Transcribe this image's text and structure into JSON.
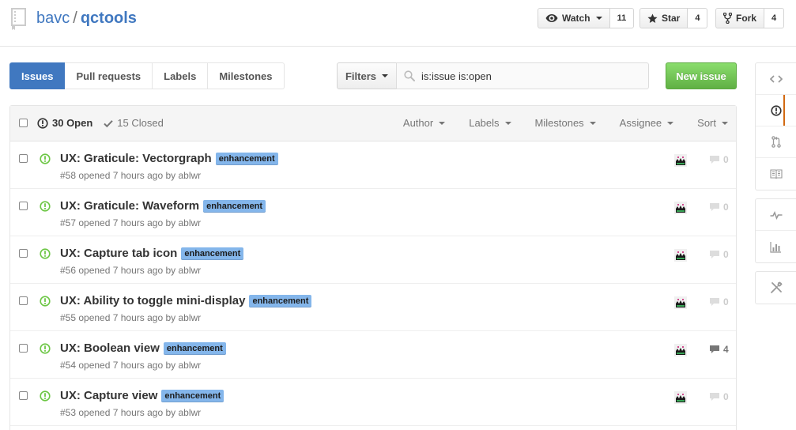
{
  "repo": {
    "owner": "bavc",
    "separator": "/",
    "name": "qctools"
  },
  "actions": {
    "watch": {
      "label": "Watch",
      "count": "11"
    },
    "star": {
      "label": "Star",
      "count": "4"
    },
    "fork": {
      "label": "Fork",
      "count": "4"
    }
  },
  "subnav": {
    "tabs": [
      {
        "label": "Issues",
        "selected": true
      },
      {
        "label": "Pull requests"
      },
      {
        "label": "Labels"
      },
      {
        "label": "Milestones"
      }
    ],
    "filters_label": "Filters",
    "search_value": "is:issue is:open",
    "new_issue_label": "New issue"
  },
  "table": {
    "open_label": "30 Open",
    "closed_label": "15 Closed",
    "menus": [
      "Author",
      "Labels",
      "Milestones",
      "Assignee",
      "Sort"
    ]
  },
  "issues": [
    {
      "title": "UX: Graticule: Vectorgraph",
      "label": "enhancement",
      "meta": "#58 opened 7 hours ago by ",
      "author": "ablwr",
      "comments": "0"
    },
    {
      "title": "UX: Graticule: Waveform",
      "label": "enhancement",
      "meta": "#57 opened 7 hours ago by ",
      "author": "ablwr",
      "comments": "0"
    },
    {
      "title": "UX: Capture tab icon",
      "label": "enhancement",
      "meta": "#56 opened 7 hours ago by ",
      "author": "ablwr",
      "comments": "0"
    },
    {
      "title": "UX: Ability to toggle mini-display",
      "label": "enhancement",
      "meta": "#55 opened 7 hours ago by ",
      "author": "ablwr",
      "comments": "0"
    },
    {
      "title": "UX: Boolean view",
      "label": "enhancement",
      "meta": "#54 opened 7 hours ago by ",
      "author": "ablwr",
      "comments": "4"
    },
    {
      "title": "UX: Capture view",
      "label": "enhancement",
      "meta": "#53 opened 7 hours ago by ",
      "author": "ablwr",
      "comments": "0"
    }
  ],
  "colors": {
    "link": "#4078c0",
    "open_icon": "#6cc644",
    "label_enhancement": "#84b6eb",
    "new_issue": "#60b044",
    "selected_nav_accent": "#d26911"
  },
  "sidebar_icons": [
    "code-icon",
    "issue-icon",
    "pull-request-icon",
    "wiki-icon",
    "pulse-icon",
    "graphs-icon",
    "settings-icon"
  ]
}
